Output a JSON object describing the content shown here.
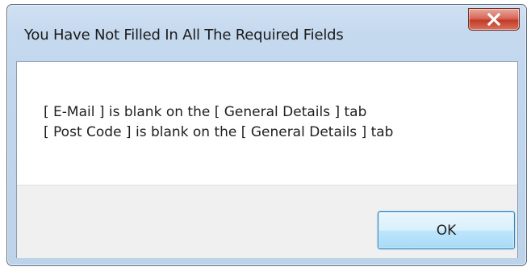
{
  "dialog": {
    "title": "You Have Not Filled In All The Required Fields",
    "close_icon": "close-icon",
    "messages": [
      "[ E-Mail ] is blank on the [ General Details ] tab",
      "[ Post Code ] is blank on the [ General Details ] tab"
    ],
    "ok_label": "OK"
  },
  "colors": {
    "close_button": "#c23b26",
    "title_bar": "#c4d8ee",
    "ok_button_border": "#3c7fb1",
    "button_area": "#f0f0f0"
  }
}
